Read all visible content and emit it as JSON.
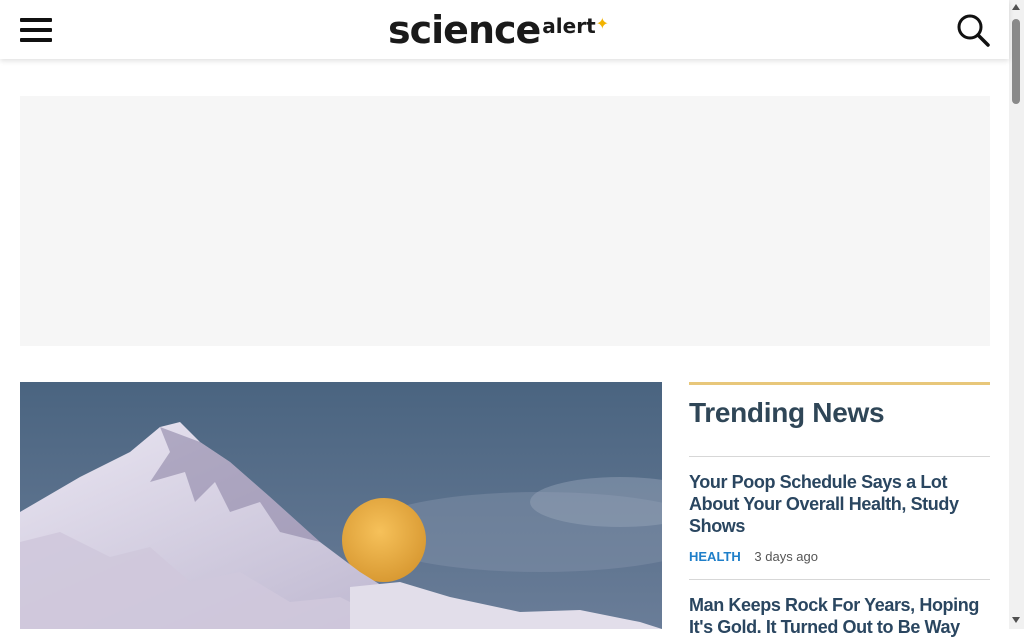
{
  "header": {
    "logo_main": "science",
    "logo_sub": "alert"
  },
  "hero": {
    "icon": "mountain-moon-photo"
  },
  "trending": {
    "title": "Trending News",
    "accent_color": "#e8c77a",
    "items": [
      {
        "title": "Your Poop Schedule Says a Lot About Your Overall Health, Study Shows",
        "category": "HEALTH",
        "time": "3 days ago"
      },
      {
        "title": "Man Keeps Rock For Years, Hoping It's Gold. It Turned Out to Be Way",
        "category": "",
        "time": ""
      }
    ]
  },
  "colors": {
    "link": "#2a4660",
    "category": "#1f7fc9",
    "logo_accent": "#f2b300"
  }
}
